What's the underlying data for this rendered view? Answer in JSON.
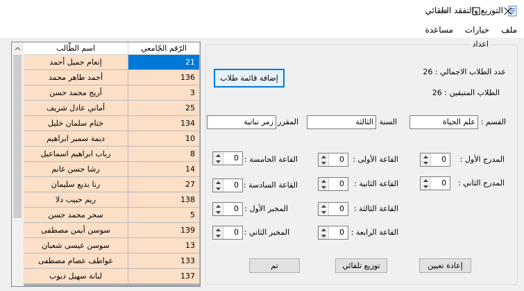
{
  "window": {
    "title": "التوزيع والتفقد التلقائي",
    "controls": [
      "minimize-icon",
      "maximize-icon",
      "close-icon"
    ]
  },
  "menu": [
    "ملف",
    "خيارات",
    "مساعدة"
  ],
  "grid": {
    "headers": {
      "id": "الرّقم الجّامعي",
      "name": "اسم الطّالب"
    },
    "rows": [
      {
        "id": "21",
        "name": "إنعام جميل أحمد"
      },
      {
        "id": "136",
        "name": "أحمد طاهر محمد"
      },
      {
        "id": "3",
        "name": "أريج محمد حسن"
      },
      {
        "id": "25",
        "name": "أماني عادل شريف"
      },
      {
        "id": "134",
        "name": "ختام سلمان خليل"
      },
      {
        "id": "10",
        "name": "ديمة سمير ابراهيم"
      },
      {
        "id": "8",
        "name": "رباب ابراهيم اسماعيل"
      },
      {
        "id": "14",
        "name": "رشا حسن غانم"
      },
      {
        "id": "27",
        "name": "رنا بديع سليمان"
      },
      {
        "id": "138",
        "name": "ريم حبيب دلا"
      },
      {
        "id": "5",
        "name": "سحر محمد حسن"
      },
      {
        "id": "139",
        "name": "سوسن أيمن مصطفى"
      },
      {
        "id": "13",
        "name": "سوسن عيسى شعبان"
      },
      {
        "id": "133",
        "name": "عواطف عصام مصطفى"
      },
      {
        "id": "137",
        "name": "لبانة سهيل ديوب"
      }
    ],
    "selected_index": 0,
    "row_color": "#fbdfc6",
    "selected_color": "#0078d7"
  },
  "settings": {
    "group_title": "اعداد",
    "add_list_button": "إضافة قائمة طلاب",
    "total_students": "عدد الطلاب الاجمالي : 26",
    "remaining_students": "الطلاب المتبقين : 26",
    "department_label": "القسم :",
    "department_value": "علم الحياة",
    "year_label": "السنة :",
    "year_value": "الثالثة",
    "course_label": "المقرر :",
    "course_value": "زمر نباتية",
    "rooms": {
      "amphi1": {
        "label": "المدرج الأول :",
        "value": "0"
      },
      "amphi2": {
        "label": "المدرج الثاني :",
        "value": "0"
      },
      "hall1": {
        "label": "القاعة الأولى :",
        "value": "0"
      },
      "hall2": {
        "label": "القاعة الثانية :",
        "value": "0"
      },
      "hall3": {
        "label": "القاعة الثالثة :",
        "value": "0"
      },
      "hall4": {
        "label": "القاعة الرابعة :",
        "value": "0"
      },
      "hall5": {
        "label": "القاعة الخامسة :",
        "value": "0"
      },
      "hall6": {
        "label": "القاعة السادسة :",
        "value": "0"
      },
      "lab1": {
        "label": "المخبر الأول :",
        "value": "0"
      },
      "lab2": {
        "label": "المخبر الثاني :",
        "value": "0"
      }
    },
    "reset_button": "إعادة تعيين",
    "auto_distribute_button": "توزيع تلقائي",
    "done_button": "تم"
  }
}
